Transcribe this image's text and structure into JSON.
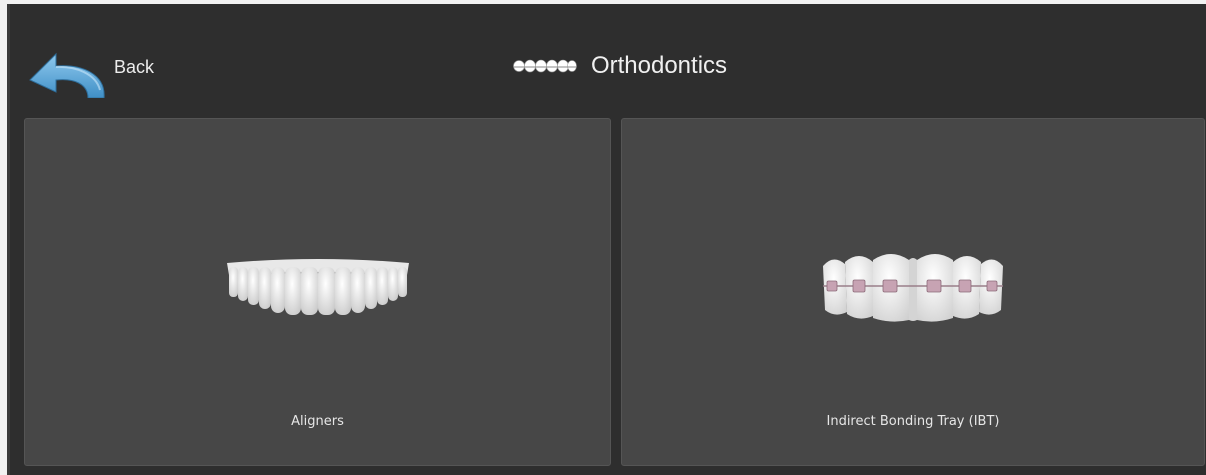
{
  "header": {
    "back_label": "Back",
    "back_icon": "back-arrow-icon",
    "title": "Orthodontics",
    "title_icon": "teeth-icon"
  },
  "tiles": [
    {
      "label": "Aligners",
      "icon": "aligners-teeth-icon"
    },
    {
      "label": "Indirect Bonding Tray (IBT)",
      "icon": "braces-teeth-icon"
    }
  ],
  "colors": {
    "background": "#2e2e2e",
    "tile": "#474747",
    "arrow": "#5aa7d8",
    "text": "#ececec"
  }
}
